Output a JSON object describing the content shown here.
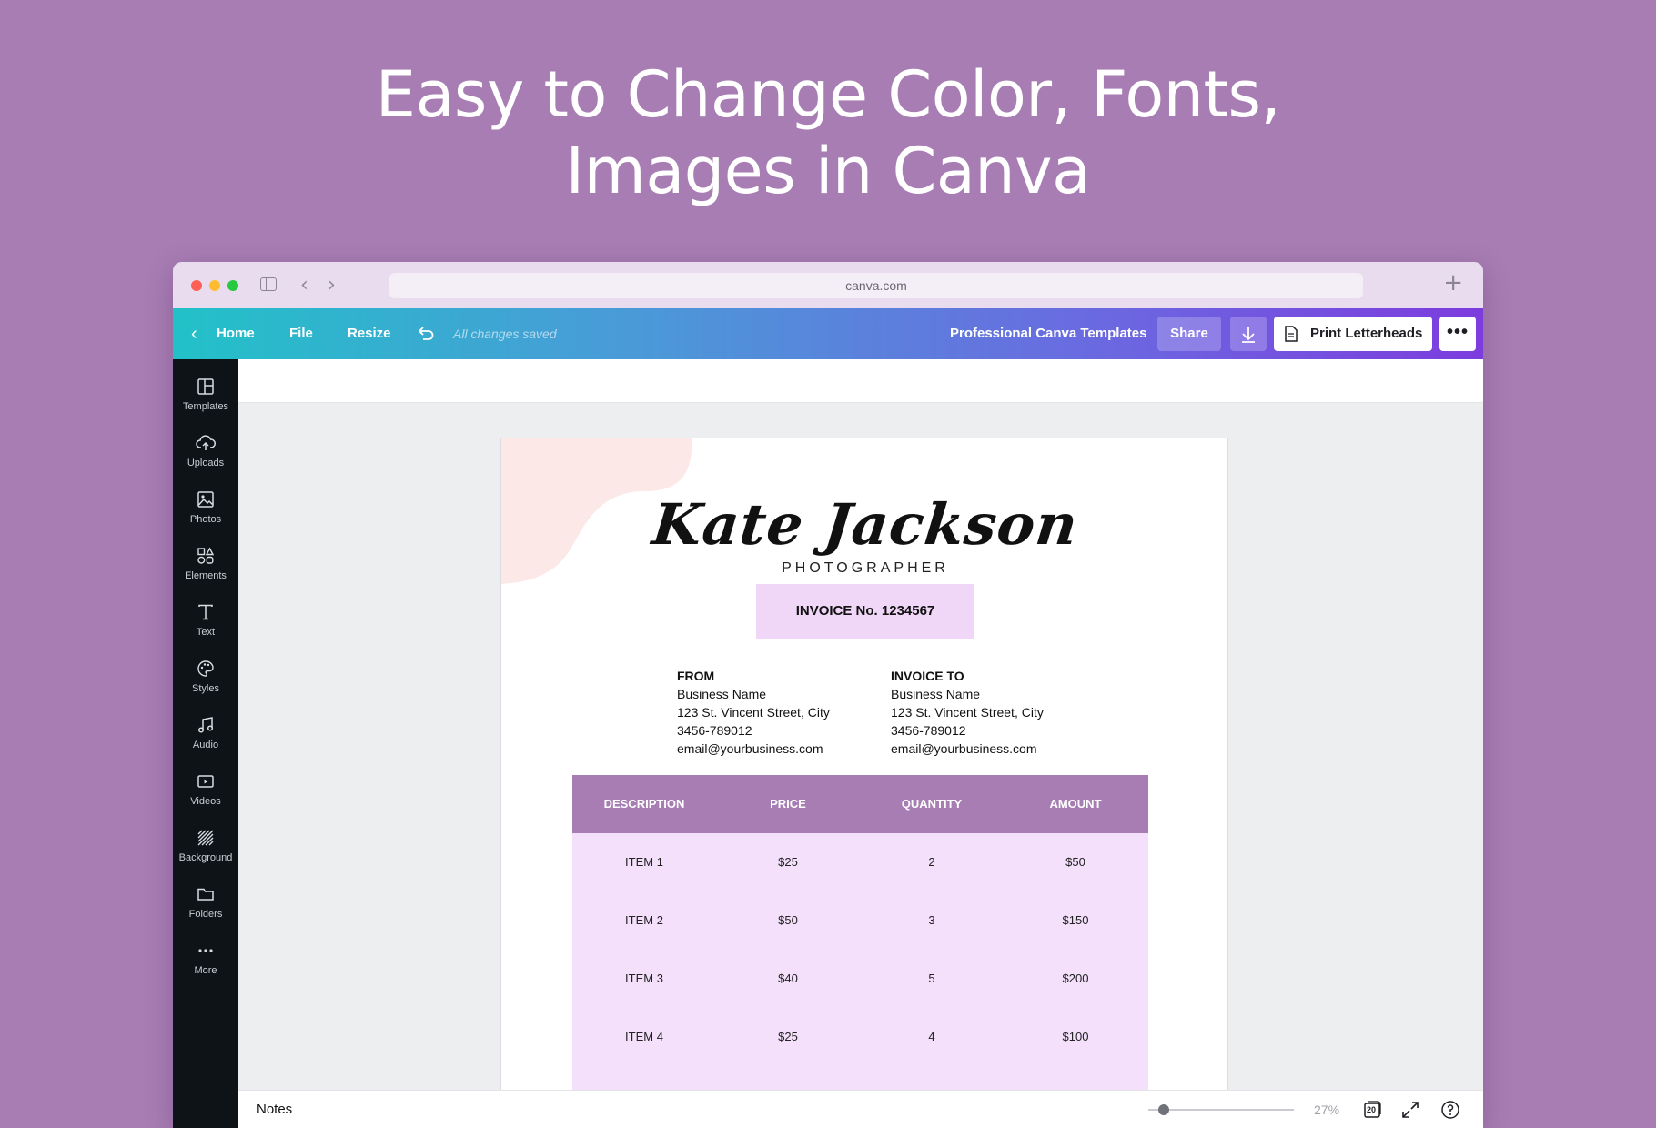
{
  "headline": {
    "line1": "Easy to Change Color, Fonts,",
    "line2": "Images in Canva"
  },
  "browser": {
    "url": "canva.com"
  },
  "toolbar": {
    "home": "Home",
    "file": "File",
    "resize": "Resize",
    "saved_status": "All changes saved",
    "design_title": "Professional Canva Templates",
    "share": "Share",
    "print": "Print Letterheads",
    "more": "•••"
  },
  "sidebar": {
    "items": [
      {
        "label": "Templates",
        "icon": "templates-icon"
      },
      {
        "label": "Uploads",
        "icon": "upload-cloud-icon"
      },
      {
        "label": "Photos",
        "icon": "photo-icon"
      },
      {
        "label": "Elements",
        "icon": "shapes-icon"
      },
      {
        "label": "Text",
        "icon": "text-icon"
      },
      {
        "label": "Styles",
        "icon": "palette-icon"
      },
      {
        "label": "Audio",
        "icon": "music-note-icon"
      },
      {
        "label": "Videos",
        "icon": "video-icon"
      },
      {
        "label": "Background",
        "icon": "background-pattern-icon"
      },
      {
        "label": "Folders",
        "icon": "folder-icon"
      },
      {
        "label": "More",
        "icon": "more-dots-icon"
      }
    ]
  },
  "invoice": {
    "name": "Kate Jackson",
    "profession": "PHOTOGRAPHER",
    "number": "INVOICE No. 1234567",
    "from": {
      "heading": "FROM",
      "business": "Business Name",
      "street": "123 St. Vincent Street, City",
      "phone": "3456-789012",
      "email": "email@yourbusiness.com"
    },
    "to": {
      "heading": "INVOICE TO",
      "business": "Business Name",
      "street": "123 St. Vincent Street, City",
      "phone": "3456-789012",
      "email": "email@yourbusiness.com"
    },
    "columns": [
      "DESCRIPTION",
      "PRICE",
      "QUANTITY",
      "AMOUNT"
    ],
    "rows": [
      [
        "ITEM 1",
        "$25",
        "2",
        "$50"
      ],
      [
        "ITEM 2",
        "$50",
        "3",
        "$150"
      ],
      [
        "ITEM 3",
        "$40",
        "5",
        "$200"
      ],
      [
        "ITEM 4",
        "$25",
        "4",
        "$100"
      ]
    ]
  },
  "bottombar": {
    "notes": "Notes",
    "zoom": "27%",
    "page_count": "20",
    "zoom_level_percent": 27
  },
  "colors": {
    "background": "#a77db3",
    "table_header": "#a77db3",
    "table_body": "#f4e0fb",
    "invoice_box": "#f0d6f7",
    "sidebar": "#0e1318"
  }
}
